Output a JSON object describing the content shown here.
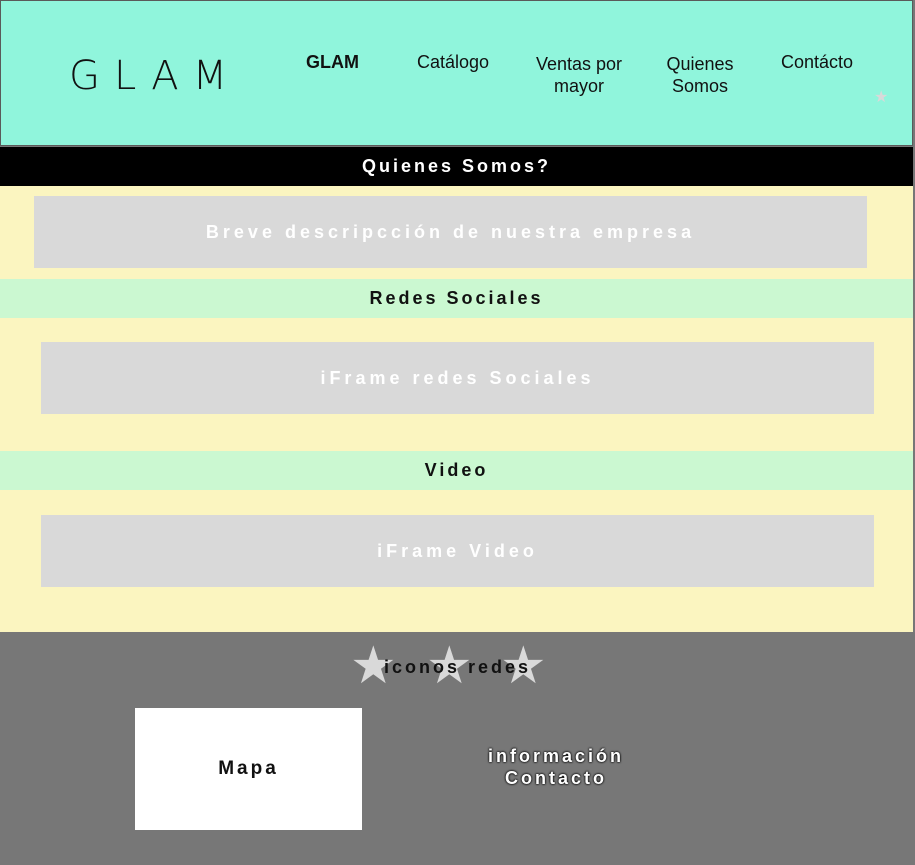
{
  "header": {
    "logo": "GLAM",
    "nav": [
      {
        "label": "GLAM"
      },
      {
        "label": "Catálogo"
      },
      {
        "label": "Ventas por mayor"
      },
      {
        "label": "Quienes Somos"
      },
      {
        "label": "Contácto"
      }
    ],
    "star_icon": "star-icon"
  },
  "about": {
    "title": "Quienes Somos?",
    "description": "Breve descripcción de nuestra empresa"
  },
  "social": {
    "title": "Redes Sociales",
    "iframe_label": "iFrame redes Sociales"
  },
  "video": {
    "title": "Video",
    "iframe_label": "iFrame Video"
  },
  "footer": {
    "icons_label": "iconos redes",
    "map_label": "Mapa",
    "contact_info": "información Contacto"
  },
  "colors": {
    "header_bg": "#90F5DC",
    "section_bg": "#FBF5C0",
    "title_bg": "#CBF8D1",
    "placeholder_bg": "#D9D9D9",
    "footer_bg": "#777777"
  }
}
